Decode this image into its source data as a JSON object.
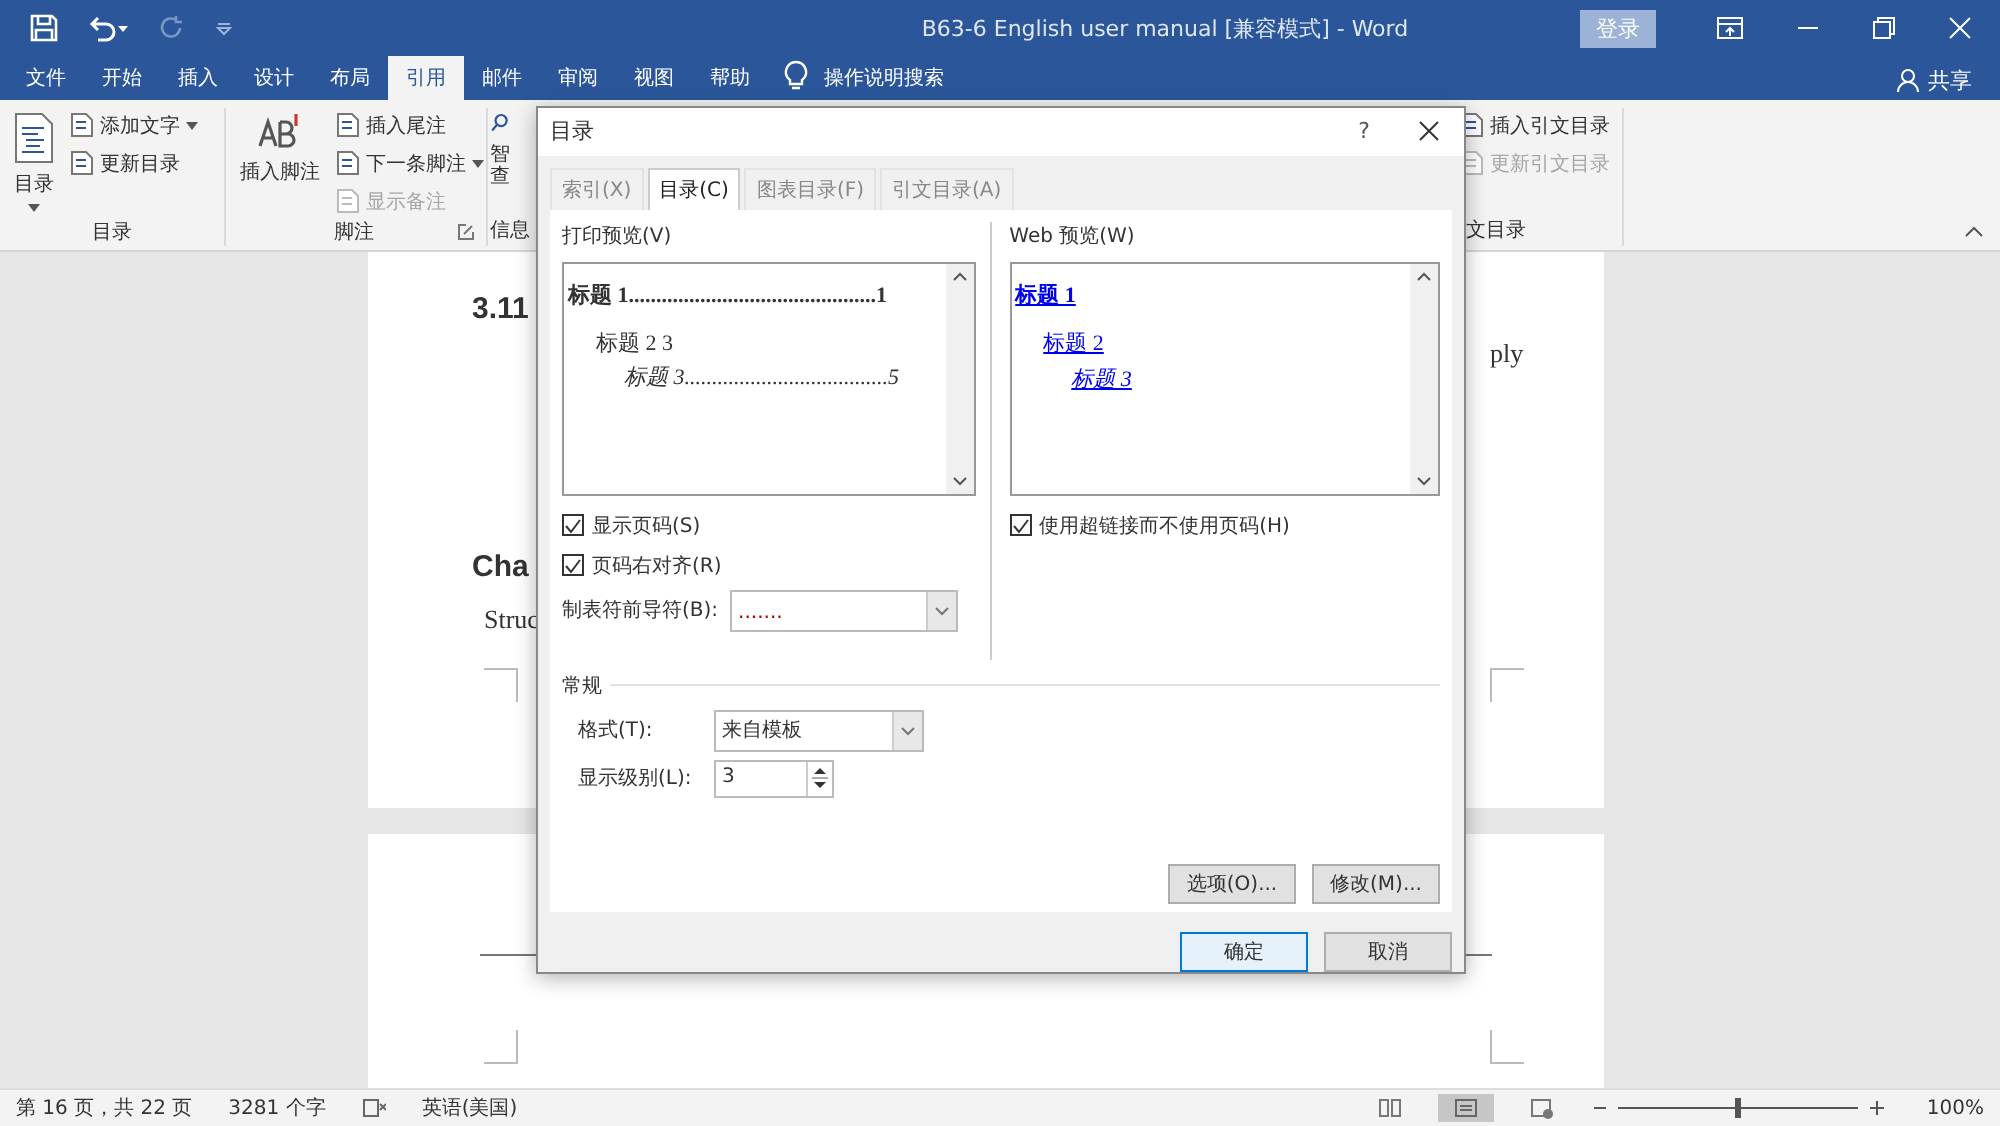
{
  "title_bar": {
    "title": "B63-6 English user manual [兼容模式]  -  Word",
    "login": "登录"
  },
  "ribbon_tabs": [
    {
      "label": "文件",
      "selected": false
    },
    {
      "label": "开始",
      "selected": false
    },
    {
      "label": "插入",
      "selected": false
    },
    {
      "label": "设计",
      "selected": false
    },
    {
      "label": "布局",
      "selected": false
    },
    {
      "label": "引用",
      "selected": true
    },
    {
      "label": "邮件",
      "selected": false
    },
    {
      "label": "审阅",
      "selected": false
    },
    {
      "label": "视图",
      "selected": false
    },
    {
      "label": "帮助",
      "selected": false
    }
  ],
  "tell_me": "操作说明搜索",
  "share": "共享",
  "ribbon_groups": [
    {
      "label": "目录",
      "big": {
        "label": "目录",
        "dropdown": true
      },
      "items": [
        {
          "label": "添加文字",
          "dropdown": true,
          "disabled": false
        },
        {
          "label": "更新目录",
          "dropdown": false,
          "disabled": false
        }
      ]
    },
    {
      "label": "脚注",
      "launcher": true,
      "big": {
        "label": "插入脚注",
        "dropdown": false
      },
      "items": [
        {
          "label": "插入尾注",
          "dropdown": false,
          "disabled": false
        },
        {
          "label": "下一条脚注",
          "dropdown": true,
          "disabled": false
        },
        {
          "label": "显示备注",
          "dropdown": false,
          "disabled": true
        }
      ]
    },
    {
      "label": "信息",
      "big": {
        "label": "智查",
        "dropdown": false
      }
    },
    {
      "label": "文目录",
      "items": [
        {
          "label": "插入引文目录",
          "dropdown": false,
          "disabled": false
        },
        {
          "label": "更新引文目录",
          "dropdown": false,
          "disabled": true
        }
      ]
    }
  ],
  "document": {
    "page_texts": [
      {
        "kind": "heading",
        "text": "3.11"
      },
      {
        "kind": "right",
        "text": "ply"
      },
      {
        "kind": "heading",
        "text": "Cha"
      },
      {
        "kind": "body",
        "text": "Struc"
      }
    ]
  },
  "dialog": {
    "title": "目录",
    "help": "?",
    "tabs": [
      {
        "label": "索引(X)",
        "selected": false
      },
      {
        "label": "目录(C)",
        "selected": true
      },
      {
        "label": "图表目录(F)",
        "selected": false
      },
      {
        "label": "引文目录(A)",
        "selected": false
      }
    ],
    "print_preview": {
      "label": "打印预览(V)",
      "lines": [
        {
          "kind": "h1",
          "text": "标题 1.............................................1"
        },
        {
          "kind": "h2",
          "text": "标题 2 3"
        },
        {
          "kind": "h3",
          "text": "标题 3.....................................5"
        }
      ]
    },
    "web_preview": {
      "label": "Web 预览(W)",
      "lines": [
        {
          "kind": "h1",
          "text": "标题 1"
        },
        {
          "kind": "h2",
          "text": "标题 2"
        },
        {
          "kind": "h3",
          "text": "标题 3"
        }
      ]
    },
    "left_checks": [
      {
        "label": "显示页码(S)",
        "checked": true
      },
      {
        "label": "页码右对齐(R)",
        "checked": true
      }
    ],
    "right_checks": [
      {
        "label": "使用超链接而不使用页码(H)",
        "checked": true
      }
    ],
    "leader": {
      "label": "制表符前导符(B):",
      "value": "......."
    },
    "general": {
      "title": "常规",
      "format": {
        "label": "格式(T):",
        "value": "来自模板"
      },
      "levels": {
        "label": "显示级别(L):",
        "value": "3"
      }
    },
    "actions": [
      "选项(O)...",
      "修改(M)..."
    ],
    "ok": "确定",
    "cancel": "取消"
  },
  "status_bar": {
    "page": "第 16 页，共 22 页",
    "words": "3281 个字",
    "language": "英语(美国)",
    "zoom_slider": {
      "level": 0.5
    },
    "zoom": "100%"
  }
}
